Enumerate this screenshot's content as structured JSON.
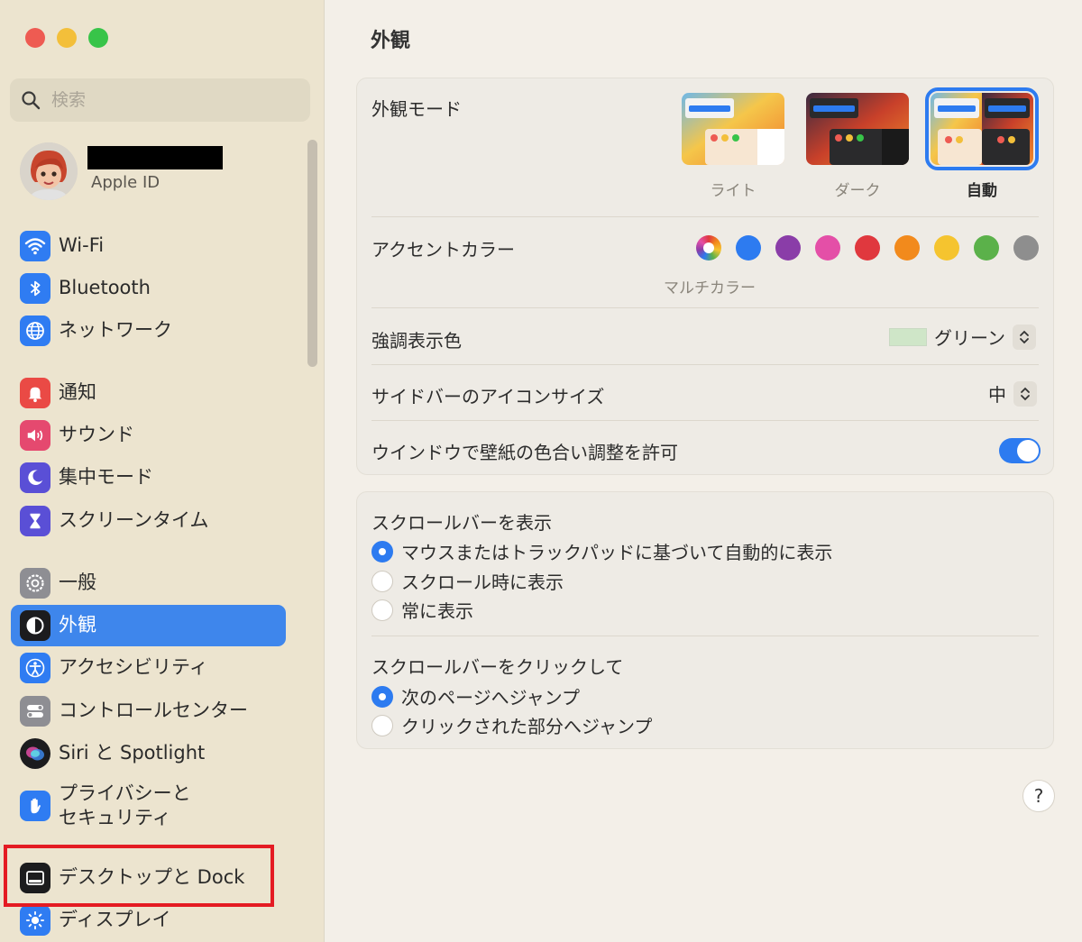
{
  "window": {
    "title": "外観"
  },
  "sidebar": {
    "search_placeholder": "検索",
    "account_label": "Apple ID",
    "items": [
      {
        "label": "Wi-Fi",
        "icon": "wifi-icon"
      },
      {
        "label": "Bluetooth",
        "icon": "bluetooth-icon"
      },
      {
        "label": "ネットワーク",
        "icon": "network-icon"
      },
      {
        "label": "通知",
        "icon": "notifications-icon"
      },
      {
        "label": "サウンド",
        "icon": "sound-icon"
      },
      {
        "label": "集中モード",
        "icon": "focus-icon"
      },
      {
        "label": "スクリーンタイム",
        "icon": "screen-time-icon"
      },
      {
        "label": "一般",
        "icon": "gear-icon"
      },
      {
        "label": "外観",
        "icon": "appearance-icon"
      },
      {
        "label": "アクセシビリティ",
        "icon": "accessibility-icon"
      },
      {
        "label": "コントロールセンター",
        "icon": "control-center-icon"
      },
      {
        "label": "Siri と Spotlight",
        "icon": "siri-icon"
      },
      {
        "label_line1": "プライバシーと",
        "label_line2": "セキュリティ",
        "icon": "hand-icon"
      },
      {
        "label": "デスクトップと Dock",
        "icon": "desktop-dock-icon"
      },
      {
        "label": "ディスプレイ",
        "icon": "display-icon"
      }
    ],
    "active_item": "外観"
  },
  "appearance": {
    "mode_label": "外観モード",
    "modes": [
      {
        "caption": "ライト",
        "selected": false
      },
      {
        "caption": "ダーク",
        "selected": false
      },
      {
        "caption": "自動",
        "selected": true
      }
    ],
    "accent_label": "アクセントカラー",
    "accent_colors": [
      "#2d7bf0",
      "#8a3da8",
      "#e44fa7",
      "#e0383e",
      "#f28a1c",
      "#f5c42f",
      "#5bb14a",
      "#8e8e8e"
    ],
    "accent_multi_caption": "マルチカラー",
    "highlight_label": "強調表示色",
    "highlight_value": "グリーン",
    "highlight_swatch": "#cfe6c8",
    "icon_size_label": "サイドバーのアイコンサイズ",
    "icon_size_value": "中",
    "tinting_label": "ウインドウで壁紙の色合い調整を許可",
    "tinting_on": true
  },
  "scroll": {
    "show_label": "スクロールバーを表示",
    "show_options": [
      "マウスまたはトラックパッドに基づいて自動的に表示",
      "スクロール時に表示",
      "常に表示"
    ],
    "show_selected": 0,
    "click_label": "スクロールバーをクリックして",
    "click_options": [
      "次のページへジャンプ",
      "クリックされた部分へジャンプ"
    ],
    "click_selected": 0
  },
  "help_label": "?",
  "colors": {
    "accent": "#2d7bf0",
    "sidebar_bg": "#ece4cf",
    "highlight_box": "#e41b23"
  }
}
